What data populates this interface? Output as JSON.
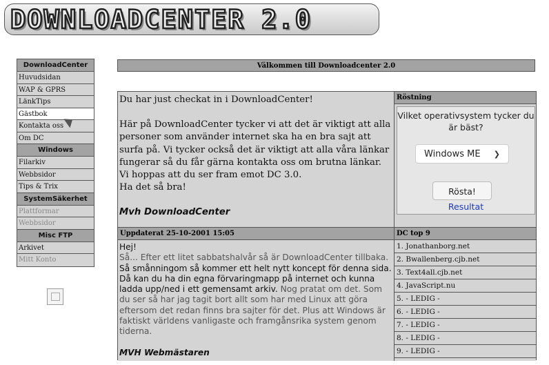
{
  "logo": {
    "text": "DOWNLOADCENTER 2.0"
  },
  "sidebar": {
    "groups": [
      {
        "title": "DownloadCenter",
        "items": [
          {
            "label": "Huvudsidan",
            "state": "normal"
          },
          {
            "label": "WAP & GPRS",
            "state": "normal"
          },
          {
            "label": "LänkTips",
            "state": "normal"
          },
          {
            "label": "Gästbok",
            "state": "active"
          },
          {
            "label": "Kontakta oss",
            "state": "normal"
          },
          {
            "label": "Om DC",
            "state": "normal"
          }
        ]
      },
      {
        "title": "Windows",
        "items": [
          {
            "label": "Filarkiv",
            "state": "normal"
          },
          {
            "label": "Webbsidor",
            "state": "normal"
          },
          {
            "label": "Tips & Trix",
            "state": "normal"
          }
        ]
      },
      {
        "title": "SystemSäkerhet",
        "items": [
          {
            "label": "Plattformar",
            "state": "dim"
          },
          {
            "label": "Webbsidor",
            "state": "dim"
          }
        ]
      },
      {
        "title": "Misc FTP",
        "items": [
          {
            "label": "Arkivet",
            "state": "normal"
          },
          {
            "label": "Mitt Konto",
            "state": "dim"
          }
        ]
      }
    ]
  },
  "header": {
    "title": "Välkommen till Downloadcenter 2.0"
  },
  "intro": {
    "line1": "Du har just checkat in i DownloadCenter!",
    "para": "Här på DownloadCenter tycker vi att det är viktigt att alla personer som använder internet ska ha en bra sajt att surfa på. Vi tycker också det är viktigt att alla våra länkar fungerar så du får gärna kontakta oss om brutna länkar. Vi hoppas att du ser fram emot DC 3.0.",
    "closing": "Ha det så bra!",
    "signature": "Mvh DownloadCenter"
  },
  "poll": {
    "header": "Röstning",
    "question": "Vilket operativsystem tycker du är bäst?",
    "selected": "Windows ME",
    "vote_label": "Rösta!",
    "results_label": "Resultat"
  },
  "update": {
    "header": "Uppdaterat 25-10-2001 15:05",
    "greeting": "Hej!",
    "gray1": "Så... Efter ett litet sabbatshalvår så är DownloadCenter tillbaka.",
    "black1": " Så smånningom så kommer ett helt nytt koncept för denna sida. Då kan du ha din egna förvaringmapp på internet och kunna ladda upp/ned i ett gemensamt arkiv.",
    "gray2": " Nog pratat om det. Som du ser så har jag tagit bort allt som har med Linux att göra eftersom det redan finns bra sajter för det. Plus att Windows är faktiskt världens vanligaste och framgånsrika system genom tiderna.",
    "signature": "MVH Webmästaren"
  },
  "top9": {
    "header": "DC top 9",
    "items": [
      "1. Jonathanborg.net",
      "2. Bwallenberg.cjb.net",
      "3. Text4all.cjb.net",
      "4. JavaScript.nu",
      "5. - LEDIG -",
      "6. - LEDIG -",
      "7. - LEDIG -",
      "8. - LEDIG -",
      "9. - LEDIG -"
    ]
  },
  "colors": {
    "bar": "#a3a3a3",
    "panel": "#d4d4d4",
    "link": "#1a39c9"
  },
  "icons": {
    "cursor": "mouse-pointer-icon",
    "broken_image": "broken-image-icon"
  }
}
